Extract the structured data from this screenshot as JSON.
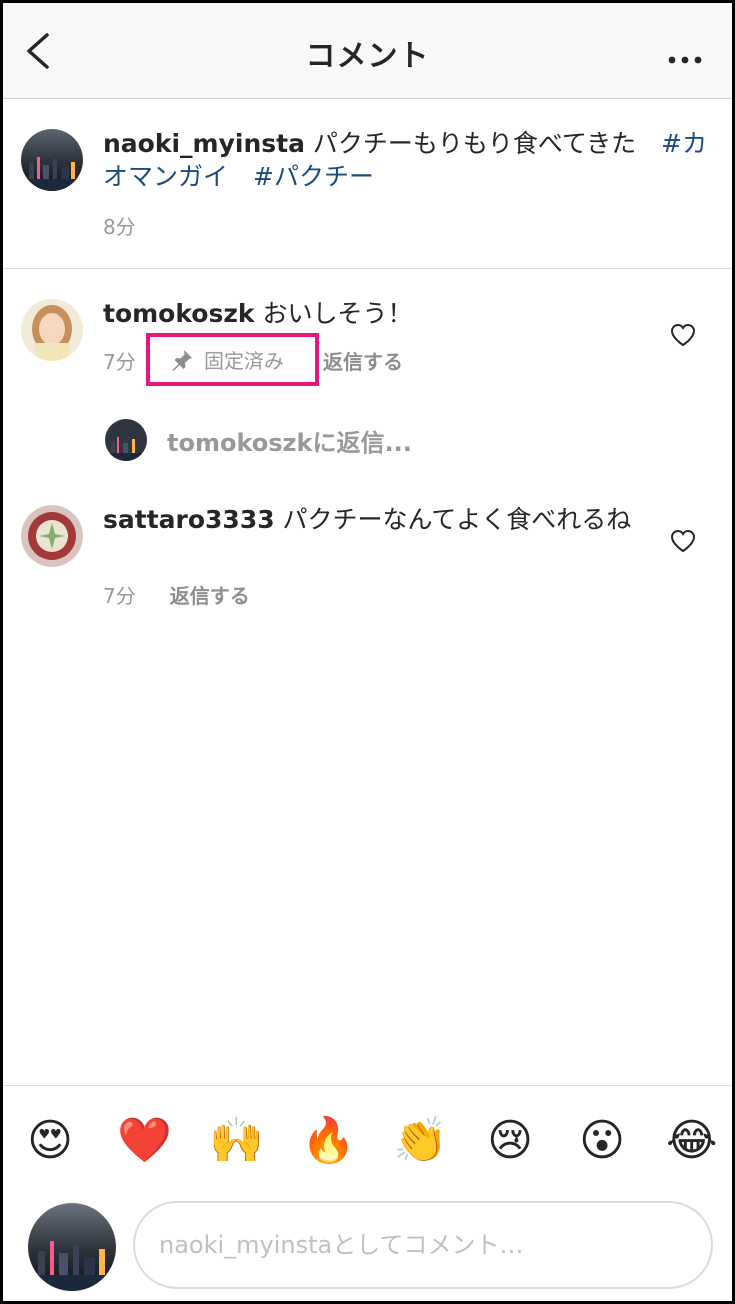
{
  "header": {
    "title": "コメント"
  },
  "caption": {
    "username": "naoki_myinsta",
    "text": " パクチーもりもり食べてきた　",
    "hashtags": [
      "#カオマンガイ",
      "#パクチー"
    ],
    "time": "8分"
  },
  "comments": [
    {
      "username": "tomokoszk",
      "text": " おいしそう！",
      "time": "7分",
      "pinned_label": "固定済み",
      "reply_label": "返信する",
      "view_replies": "tomokoszkに返信..."
    },
    {
      "username": "sattaro3333",
      "text": " パクチーなんてよく食べれるね",
      "time": "7分",
      "reply_label": "返信する"
    }
  ],
  "emoji_bar": [
    "😍",
    "❤️",
    "🙌",
    "🔥",
    "👏",
    "😢",
    "😮",
    "😂"
  ],
  "input": {
    "placeholder": "naoki_myinstaとしてコメント…"
  },
  "colors": {
    "hashtag": "#1b4c7d",
    "pin_highlight": "#e6157f",
    "muted": "#999999"
  },
  "icons": [
    "back-icon",
    "more-icon",
    "pin-icon",
    "heart-icon"
  ]
}
